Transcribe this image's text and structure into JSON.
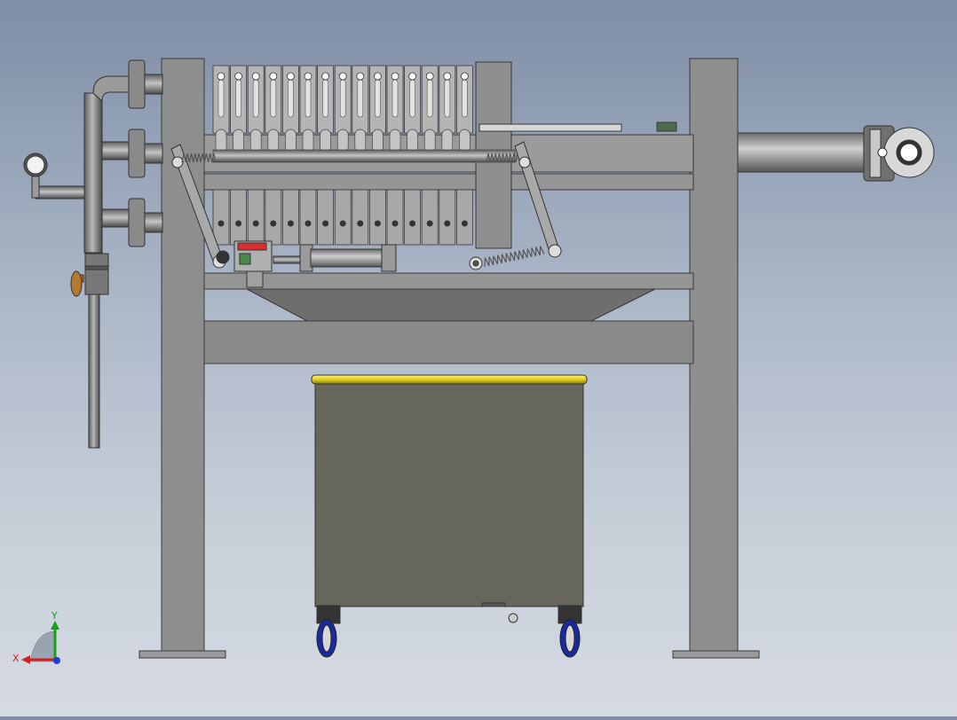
{
  "viewport": {
    "background_top": "#7f8ea6",
    "background_bottom": "#d5dae2"
  },
  "triad": {
    "x_label": "X",
    "y_label": "Y",
    "x_color": "#d62020",
    "y_color": "#18a018",
    "z_color": "#2040d0"
  },
  "model": {
    "steel_color": "#8c8c8c",
    "tank_color": "#66665a",
    "tank_rim_color": "#e0d020",
    "wheel_color": "#1a2aa0",
    "filter_plate_count": 15
  }
}
